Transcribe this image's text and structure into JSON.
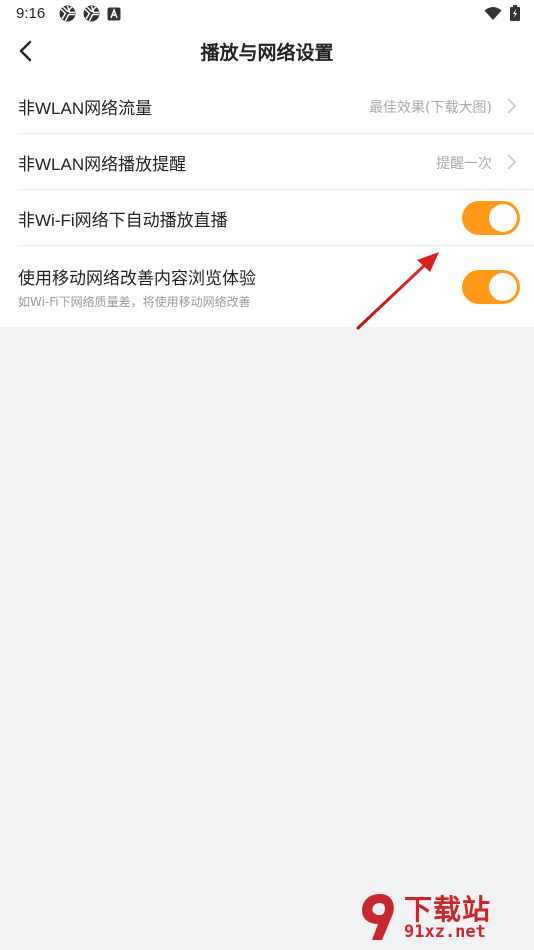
{
  "status_bar": {
    "time": "9:16",
    "left_icons": [
      "aperture-icon",
      "aperture-icon",
      "keyboard-a-icon"
    ],
    "right_icons": [
      "wifi-icon",
      "battery-charging-icon"
    ]
  },
  "header": {
    "title": "播放与网络设置"
  },
  "settings": {
    "row1": {
      "label": "非WLAN网络流量",
      "value": "最佳效果(下载大图)"
    },
    "row2": {
      "label": "非WLAN网络播放提醒",
      "value": "提醒一次"
    },
    "row3": {
      "label": "非Wi-Fi网络下自动播放直播",
      "toggle_on": true
    },
    "row4": {
      "label": "使用移动网络改善内容浏览体验",
      "sublabel": "如Wi-Fi下网络质量差，将使用移动网络改善",
      "toggle_on": true
    }
  },
  "colors": {
    "accent": "#fe9a17",
    "annotation_arrow": "#d61f1f",
    "watermark": "#c8282d"
  },
  "watermark": {
    "brand": "下载站",
    "site": "91xz.net"
  }
}
